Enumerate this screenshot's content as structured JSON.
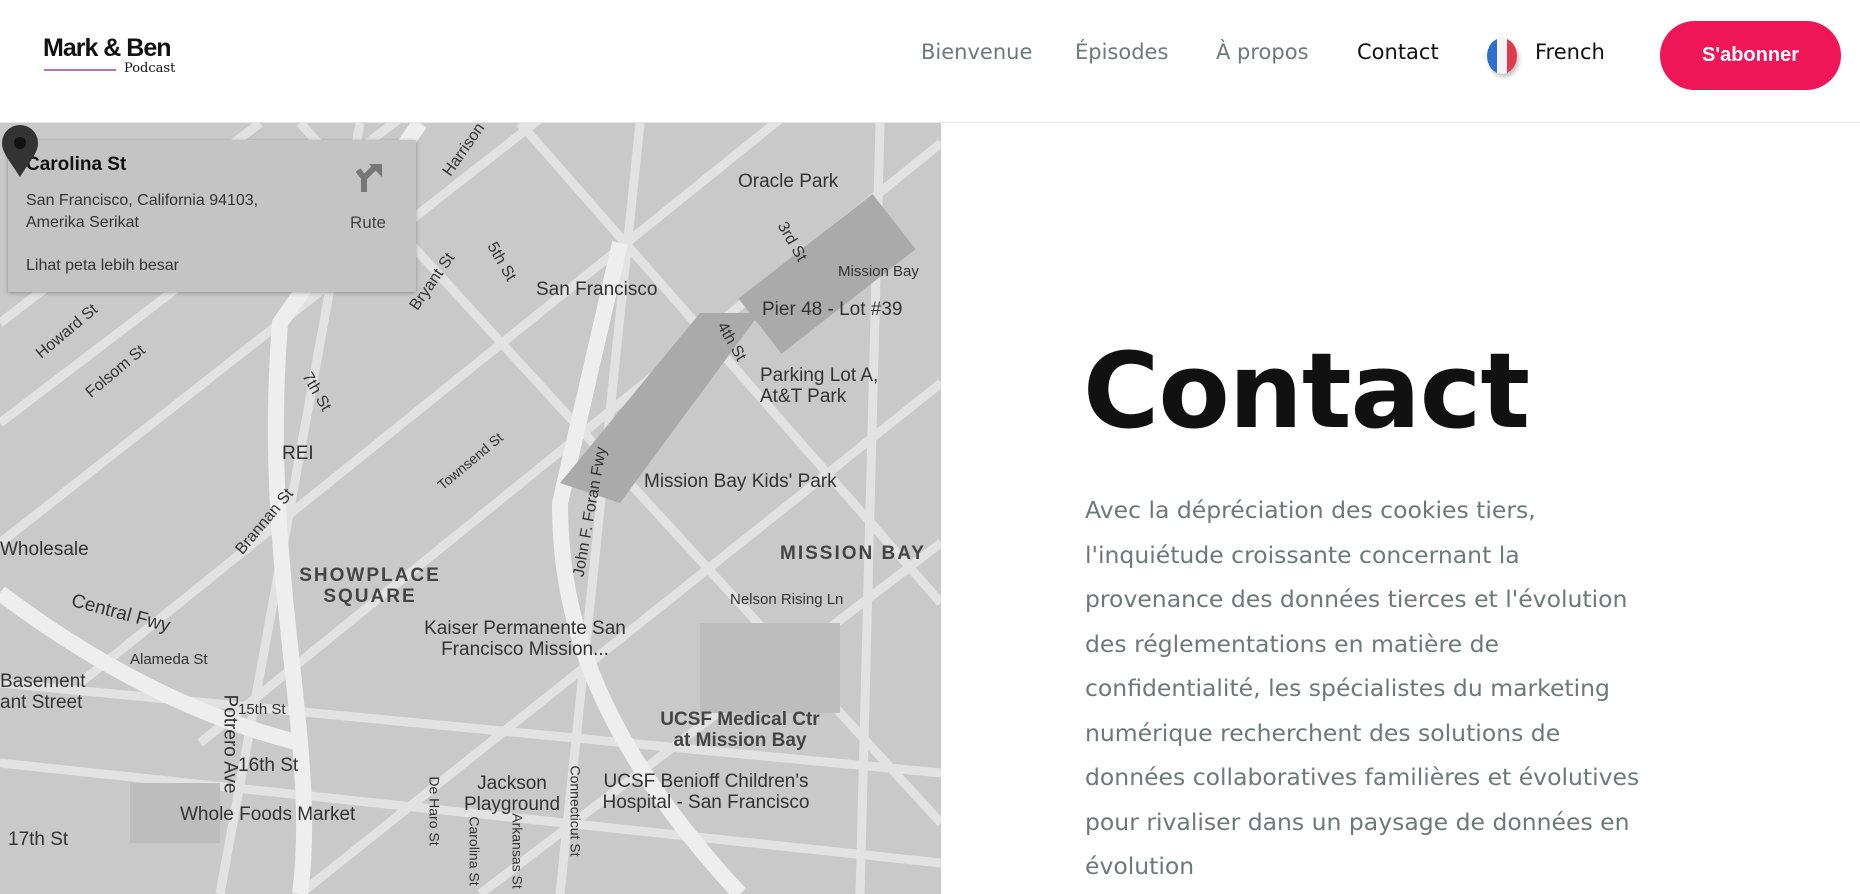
{
  "header": {
    "logo_title": "Mark & Ben",
    "logo_sub": "Podcast",
    "nav": [
      "Bienvenue",
      "Épisodes",
      "À propos",
      "Contact"
    ],
    "language": "French",
    "subscribe": "S'abonner",
    "accent": "#ef1657"
  },
  "map": {
    "card": {
      "name": "Carolina St",
      "address": "San Francisco, California 94103, Amerika Serikat",
      "larger_map": "Lihat peta lebih besar",
      "directions": "Rute"
    },
    "labels": [
      "Oracle Park",
      "San Francisco",
      "Mission Bay",
      "Pier 48 - Lot #39",
      "Parking Lot A, At&T Park",
      "Mission Bay Kids' Park",
      "MISSION BAY",
      "SHOWPLACE SQUARE",
      "REI",
      "Wholesale",
      "Kaiser Permanente San Francisco Mission...",
      "UCSF Medical Ctr at Mission Bay",
      "UCSF Benioff Children's Hospital - San Francisco",
      "Jackson Playground",
      "Whole Foods Market",
      "Central Fwy",
      "Basement ant Street",
      "Nelson Rising Ln",
      "John F. Foran Fwy",
      "Townsend St",
      "Brannan St",
      "Bryant St",
      "Harrison St",
      "Folsom St",
      "Howard St",
      "7th St",
      "5th St",
      "4th St",
      "3rd St",
      "16th St",
      "17th St",
      "Potrero Ave",
      "Carolina St",
      "De Haro St",
      "Arkansas St",
      "Connecticut St",
      "Alameda St",
      "15th St"
    ]
  },
  "main": {
    "title": "Contact",
    "paragraph": "Avec la dépréciation des cookies tiers, l'inquiétude croissante concernant la provenance des données tierces et l'évolution des réglementations en matière de confidentialité, les spécialistes du marketing numérique recherchent des solutions de données collaboratives familières et évolutives pour rivaliser dans un paysage de données en évolution"
  }
}
